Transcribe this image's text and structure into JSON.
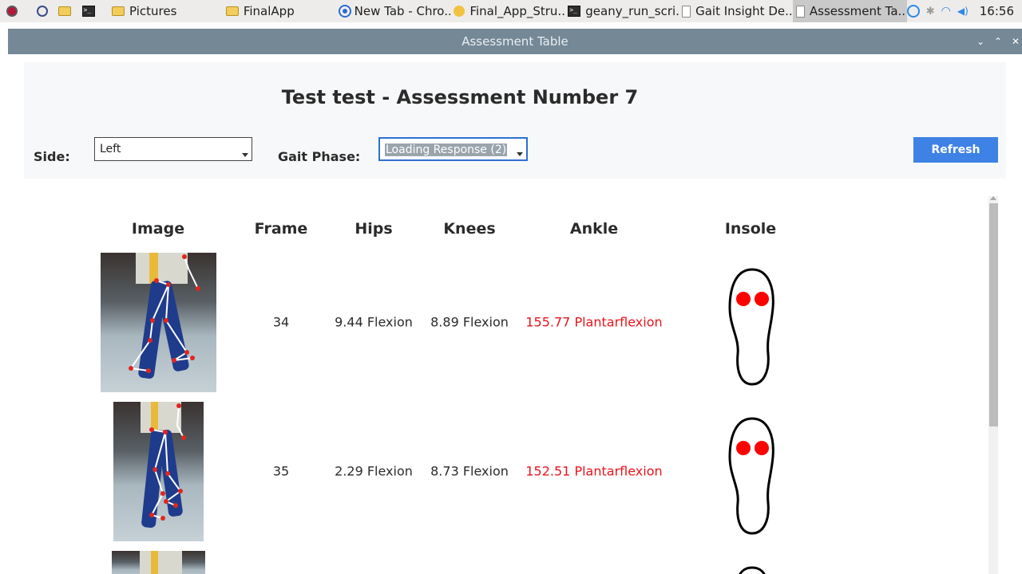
{
  "taskbar": {
    "launchers": [
      "raspberry-menu-icon",
      "web-browser-icon",
      "file-manager-icon",
      "terminal-icon"
    ],
    "items": [
      {
        "label": "Pictures",
        "icon": "folder-icon"
      },
      {
        "label": "FinalApp",
        "icon": "folder-icon"
      },
      {
        "label": "New Tab - Chro..",
        "icon": "chromium-icon"
      },
      {
        "label": "Final_App_Stru..",
        "icon": "document-viewer-icon"
      },
      {
        "label": "geany_run_scri..",
        "icon": "terminal-icon"
      },
      {
        "label": "Gait Insight De..",
        "icon": "window-icon"
      },
      {
        "label": "Assessment Ta..",
        "icon": "window-icon",
        "active": true
      }
    ],
    "tray": [
      "updates-icon",
      "bluetooth-icon",
      "wifi-icon",
      "volume-icon"
    ],
    "clock": "16:56"
  },
  "window": {
    "title": "Assessment Table",
    "controls": [
      "minimize-icon",
      "maximize-icon",
      "close-icon"
    ]
  },
  "header": {
    "title": "Test test - Assessment Number 7",
    "side_label": "Side:",
    "side_value": "Left",
    "phase_label": "Gait Phase:",
    "phase_value": "Loading Response (2)",
    "refresh_label": "Refresh"
  },
  "table": {
    "columns": [
      "Image",
      "Frame",
      "Hips",
      "Knees",
      "Ankle",
      "Insole"
    ],
    "rows": [
      {
        "frame": "34",
        "hips": "9.44 Flexion",
        "knees": "8.89 Flexion",
        "ankle": "155.77 Plantarflexion",
        "ankle_alert": true
      },
      {
        "frame": "35",
        "hips": "2.29 Flexion",
        "knees": "8.73 Flexion",
        "ankle": "152.51 Plantarflexion",
        "ankle_alert": true
      }
    ]
  },
  "colors": {
    "titlebar": "#748896",
    "accent": "#3f82e6",
    "alert": "#e8141b"
  }
}
